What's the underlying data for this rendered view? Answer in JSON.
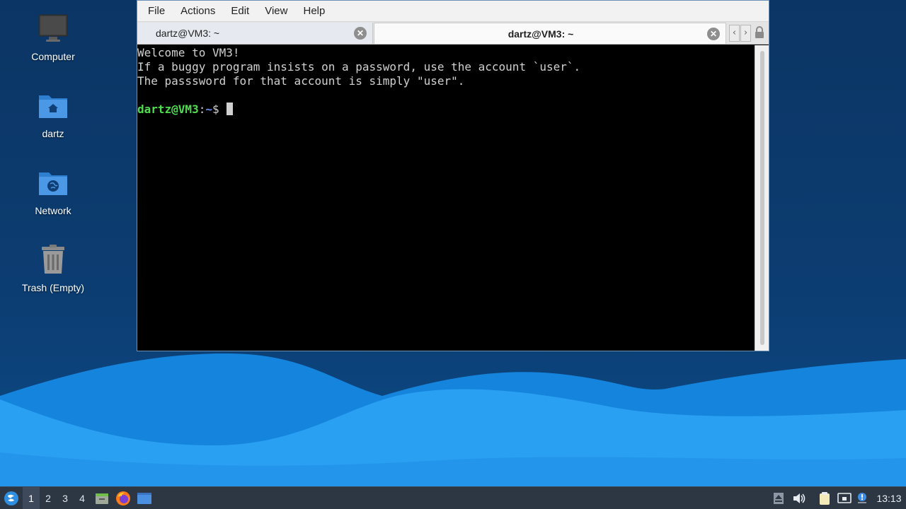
{
  "desktop": {
    "icons": [
      {
        "label": "Computer",
        "icon": "computer-icon"
      },
      {
        "label": "dartz",
        "icon": "home-folder-icon"
      },
      {
        "label": "Network",
        "icon": "network-folder-icon"
      },
      {
        "label": "Trash (Empty)",
        "icon": "trash-icon"
      }
    ]
  },
  "terminal": {
    "menu": [
      "File",
      "Actions",
      "Edit",
      "View",
      "Help"
    ],
    "tabs": [
      {
        "label": "dartz@VM3: ~",
        "active": false
      },
      {
        "label": "dartz@VM3: ~",
        "active": true
      }
    ],
    "output": [
      "Welcome to VM3!",
      "If a buggy program insists on a password, use the account `user`.",
      "The passsword for that account is simply \"user\"."
    ],
    "prompt": {
      "user_host": "dartz@VM3",
      "sep": ":",
      "path": "~",
      "symbol": "$"
    }
  },
  "taskbar": {
    "workspaces": [
      "1",
      "2",
      "3",
      "4"
    ],
    "active_workspace": "1",
    "clock": "13:13"
  },
  "colors": {
    "terminal_bg": "#000000",
    "prompt_user": "#4fdc4f",
    "prompt_path": "#6f8ff0",
    "wave_light": "#2ea0f0",
    "taskbar_bg": "#2d3744"
  }
}
